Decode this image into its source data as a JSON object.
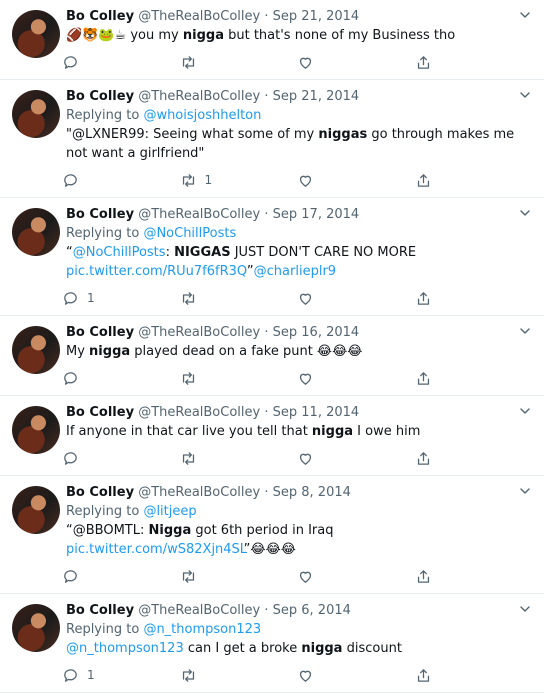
{
  "tweets": [
    {
      "name": "Bo Colley",
      "handle": "@TheRealBoColley",
      "sep": "·",
      "date": "Sep 21, 2014",
      "reply_prefix": "",
      "reply_to": "",
      "segments": [
        {
          "t": "🏈🐯🐸☕ ",
          "kind": "emoji"
        },
        {
          "t": "you my ",
          "kind": "text"
        },
        {
          "t": "nigga",
          "kind": "bold"
        },
        {
          "t": " but that's none of my Business tho",
          "kind": "text"
        }
      ],
      "reply_count": "",
      "retweet_count": ""
    },
    {
      "name": "Bo Colley",
      "handle": "@TheRealBoColley",
      "sep": "·",
      "date": "Sep 21, 2014",
      "reply_prefix": "Replying to ",
      "reply_to": "@whoisjoshhelton",
      "segments": [
        {
          "t": "\"@LXNER99: Seeing what some of my ",
          "kind": "text"
        },
        {
          "t": "niggas",
          "kind": "bold"
        },
        {
          "t": " go through makes me not want a girlfriend\"",
          "kind": "text"
        }
      ],
      "reply_count": "",
      "retweet_count": "1"
    },
    {
      "name": "Bo Colley",
      "handle": "@TheRealBoColley",
      "sep": "·",
      "date": "Sep 17, 2014",
      "reply_prefix": "Replying to ",
      "reply_to": "@NoChillPosts",
      "segments": [
        {
          "t": "“",
          "kind": "text"
        },
        {
          "t": "@NoChillPosts",
          "kind": "link"
        },
        {
          "t": ": ",
          "kind": "text"
        },
        {
          "t": "NIGGAS",
          "kind": "bold"
        },
        {
          "t": " JUST DON'T CARE NO MORE ",
          "kind": "text"
        },
        {
          "t": "pic.twitter.com/RUu7f6fR3Q",
          "kind": "link"
        },
        {
          "t": "”",
          "kind": "text"
        },
        {
          "t": "@charlieplr9",
          "kind": "link"
        }
      ],
      "reply_count": "1",
      "retweet_count": ""
    },
    {
      "name": "Bo Colley",
      "handle": "@TheRealBoColley",
      "sep": "·",
      "date": "Sep 16, 2014",
      "reply_prefix": "",
      "reply_to": "",
      "segments": [
        {
          "t": "My ",
          "kind": "text"
        },
        {
          "t": "nigga",
          "kind": "bold"
        },
        {
          "t": " played dead on a fake punt ",
          "kind": "text"
        },
        {
          "t": "😂😂😂",
          "kind": "emoji"
        }
      ],
      "reply_count": "",
      "retweet_count": ""
    },
    {
      "name": "Bo Colley",
      "handle": "@TheRealBoColley",
      "sep": "·",
      "date": "Sep 11, 2014",
      "reply_prefix": "",
      "reply_to": "",
      "segments": [
        {
          "t": "If anyone in that car live you tell that ",
          "kind": "text"
        },
        {
          "t": "nigga",
          "kind": "bold"
        },
        {
          "t": " I owe him",
          "kind": "text"
        }
      ],
      "reply_count": "",
      "retweet_count": ""
    },
    {
      "name": "Bo Colley",
      "handle": "@TheRealBoColley",
      "sep": "·",
      "date": "Sep 8, 2014",
      "reply_prefix": "Replying to ",
      "reply_to": "@litjeep",
      "segments": [
        {
          "t": "“@BBOMTL: ",
          "kind": "text"
        },
        {
          "t": "Nigga",
          "kind": "bold"
        },
        {
          "t": " got 6th period in Iraq ",
          "kind": "text"
        },
        {
          "t": "pic.twitter.com/wS82Xjn4SL",
          "kind": "link"
        },
        {
          "t": "”",
          "kind": "text"
        },
        {
          "t": "😂😂😂",
          "kind": "emoji"
        }
      ],
      "reply_count": "",
      "retweet_count": ""
    },
    {
      "name": "Bo Colley",
      "handle": "@TheRealBoColley",
      "sep": "·",
      "date": "Sep 6, 2014",
      "reply_prefix": "Replying to ",
      "reply_to": "@n_thompson123",
      "segments": [
        {
          "t": "@n_thompson123",
          "kind": "link"
        },
        {
          "t": " can I get a broke ",
          "kind": "text"
        },
        {
          "t": "nigga",
          "kind": "bold"
        },
        {
          "t": " discount",
          "kind": "text"
        }
      ],
      "reply_count": "1",
      "retweet_count": ""
    }
  ],
  "icons": {
    "reply": "reply-icon",
    "retweet": "retweet-icon",
    "like": "like-icon",
    "share": "share-icon",
    "more": "chevron-down-icon"
  },
  "colors": {
    "link": "#1d9bf0",
    "muted": "#536471",
    "divider": "#e6ecf0"
  }
}
